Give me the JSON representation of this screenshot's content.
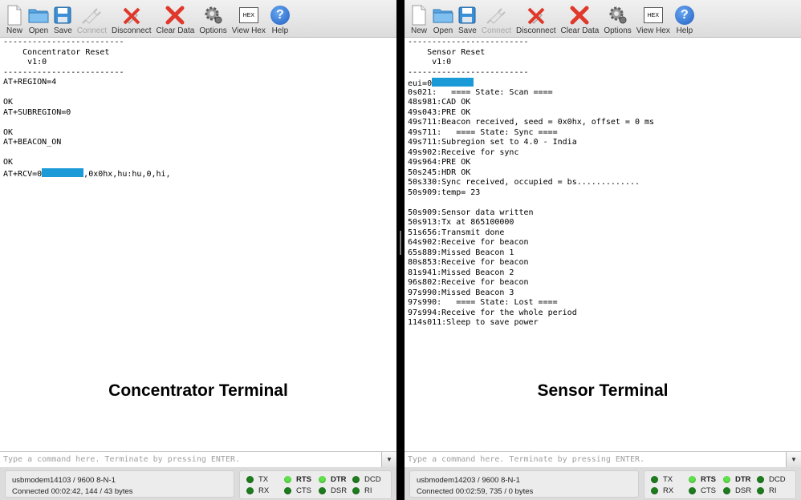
{
  "toolbar": {
    "new_label": "New",
    "open_label": "Open",
    "save_label": "Save",
    "connect_label": "Connect",
    "disconnect_label": "Disconnect",
    "clear_data_label": "Clear Data",
    "options_label": "Options",
    "view_hex_label": "View Hex",
    "hex_icon_text": "HEX",
    "help_label": "Help",
    "help_icon_text": "?"
  },
  "left": {
    "lines": [
      "-------------------------",
      "    Concentrator Reset",
      "     v1:0",
      "-------------------------",
      "AT+REGION=4",
      "",
      "OK",
      "AT+SUBREGION=0",
      "",
      "OK",
      "AT+BEACON_ON",
      "",
      "OK"
    ],
    "rcv_prefix": "AT+RCV=0",
    "rcv_suffix": ",0x0hx,hu:hu,0,hi,",
    "overlay_label": "Concentrator Terminal",
    "cmd_placeholder": "Type a command here. Terminate by pressing ENTER.",
    "port": "usbmodem14103 / 9600 8-N-1",
    "connected": "Connected 00:02:42, 144 / 43 bytes"
  },
  "right": {
    "lines_top": [
      "-------------------------",
      "    Sensor Reset",
      "     v1:0",
      "-------------------------"
    ],
    "eui_prefix": "eui=0",
    "lines": [
      "0s021:   ==== State: Scan ====",
      "48s981:CAD OK",
      "49s043:PRE OK",
      "49s711:Beacon received, seed = 0x0hx, offset = 0 ms",
      "49s711:   ==== State: Sync ====",
      "49s711:Subregion set to 4.0 - India",
      "49s902:Receive for sync",
      "49s964:PRE OK",
      "50s245:HDR OK",
      "50s330:Sync received, occupied = bs.............",
      "50s909:temp= 23",
      "",
      "50s909:Sensor data written",
      "50s913:Tx at 865100000",
      "51s656:Transmit done",
      "64s902:Receive for beacon",
      "65s889:Missed Beacon 1",
      "80s853:Receive for beacon",
      "81s941:Missed Beacon 2",
      "96s802:Receive for beacon",
      "97s990:Missed Beacon 3",
      "97s990:   ==== State: Lost ====",
      "97s994:Receive for the whole period",
      "114s011:Sleep to save power"
    ],
    "overlay_label": "Sensor Terminal",
    "cmd_placeholder": "Type a command here. Terminate by pressing ENTER.",
    "port": "usbmodem14203 / 9600 8-N-1",
    "connected": "Connected 00:02:59, 735 / 0 bytes"
  },
  "signals": {
    "tx": "TX",
    "rx": "RX",
    "rts": "RTS",
    "cts": "CTS",
    "dtr": "DTR",
    "dsr": "DSR",
    "dcd": "DCD",
    "ri": "RI"
  },
  "colors": {
    "redaction": "#1a9ad6",
    "led_on": "#5fe34a",
    "led_off": "#1e7d1e"
  }
}
